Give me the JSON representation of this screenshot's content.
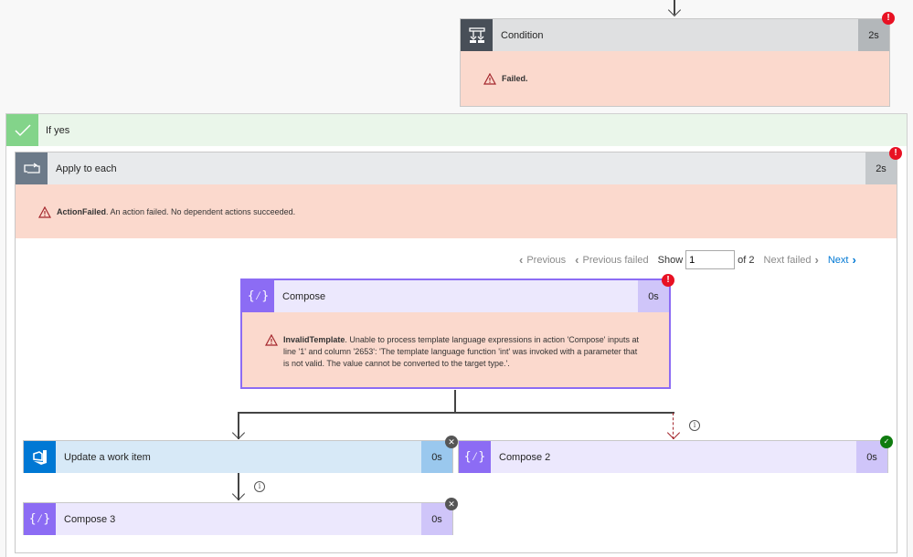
{
  "condition": {
    "title": "Condition",
    "duration": "2s",
    "status": "error",
    "error_label": "Failed.",
    "icon": "condition-icon"
  },
  "if_yes": {
    "label": "If yes",
    "icon": "checkmark-icon"
  },
  "apply_to_each": {
    "title": "Apply to each",
    "duration": "2s",
    "status": "error",
    "error_code": "ActionFailed",
    "error_message": ". An action failed. No dependent actions succeeded.",
    "icon": "loop-icon"
  },
  "pager": {
    "previous": "Previous",
    "previous_failed": "Previous failed",
    "show_label": "Show",
    "current": "1",
    "of_label": "of 2",
    "next_failed": "Next failed",
    "next": "Next"
  },
  "compose": {
    "title": "Compose",
    "duration": "0s",
    "status": "error",
    "error_code": "InvalidTemplate",
    "error_message": ". Unable to process template language expressions in action 'Compose' inputs at line '1' and column '2653': 'The template language function 'int' was invoked with a parameter that is not valid. The value cannot be converted to the target type.'.",
    "icon": "compose-icon"
  },
  "update_work_item": {
    "title": "Update a work item",
    "duration": "0s",
    "status": "skipped",
    "icon": "azure-devops-icon"
  },
  "compose2": {
    "title": "Compose 2",
    "duration": "0s",
    "status": "succeeded",
    "icon": "compose-icon"
  },
  "compose3": {
    "title": "Compose 3",
    "duration": "0s",
    "status": "skipped",
    "icon": "compose-icon"
  },
  "colors": {
    "error_bg": "#fbd9cd",
    "error_badge": "#e81123",
    "success_badge": "#107c10",
    "compose_purple": "#8c6cf4",
    "devops_blue": "#0078d4",
    "link_blue": "#0078d4"
  }
}
